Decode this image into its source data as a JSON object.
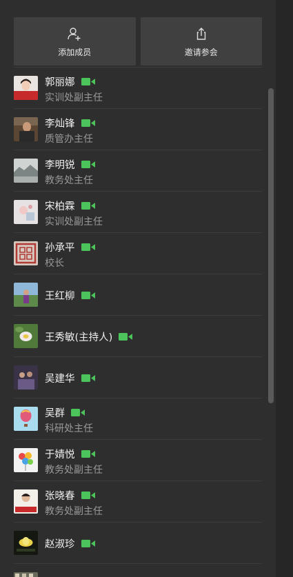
{
  "actions": {
    "add_member_label": "添加成员",
    "invite_label": "邀请参会"
  },
  "participants": [
    {
      "name": "郭丽娜",
      "title": "实训处副主任"
    },
    {
      "name": "李灿锋",
      "title": "质管办主任"
    },
    {
      "name": "李明锐",
      "title": "教务处主任"
    },
    {
      "name": "宋柏霖",
      "title": "实训处副主任"
    },
    {
      "name": "孙承平",
      "title": "校长"
    },
    {
      "name": "王红柳",
      "title": ""
    },
    {
      "name": "王秀敏(主持人)",
      "title": ""
    },
    {
      "name": "吴建华",
      "title": ""
    },
    {
      "name": "吴群",
      "title": "科研处主任"
    },
    {
      "name": "于婧悦",
      "title": "教务处副主任"
    },
    {
      "name": "张晓春",
      "title": "教务处副主任"
    },
    {
      "name": "赵淑珍",
      "title": ""
    }
  ],
  "colors": {
    "camera_on": "#4cc35b",
    "panel_bg": "#2e2e2e",
    "button_bg": "#404040"
  },
  "icons": {
    "add_member": "add-user-icon",
    "invite": "share-icon",
    "camera": "video-camera-icon"
  }
}
